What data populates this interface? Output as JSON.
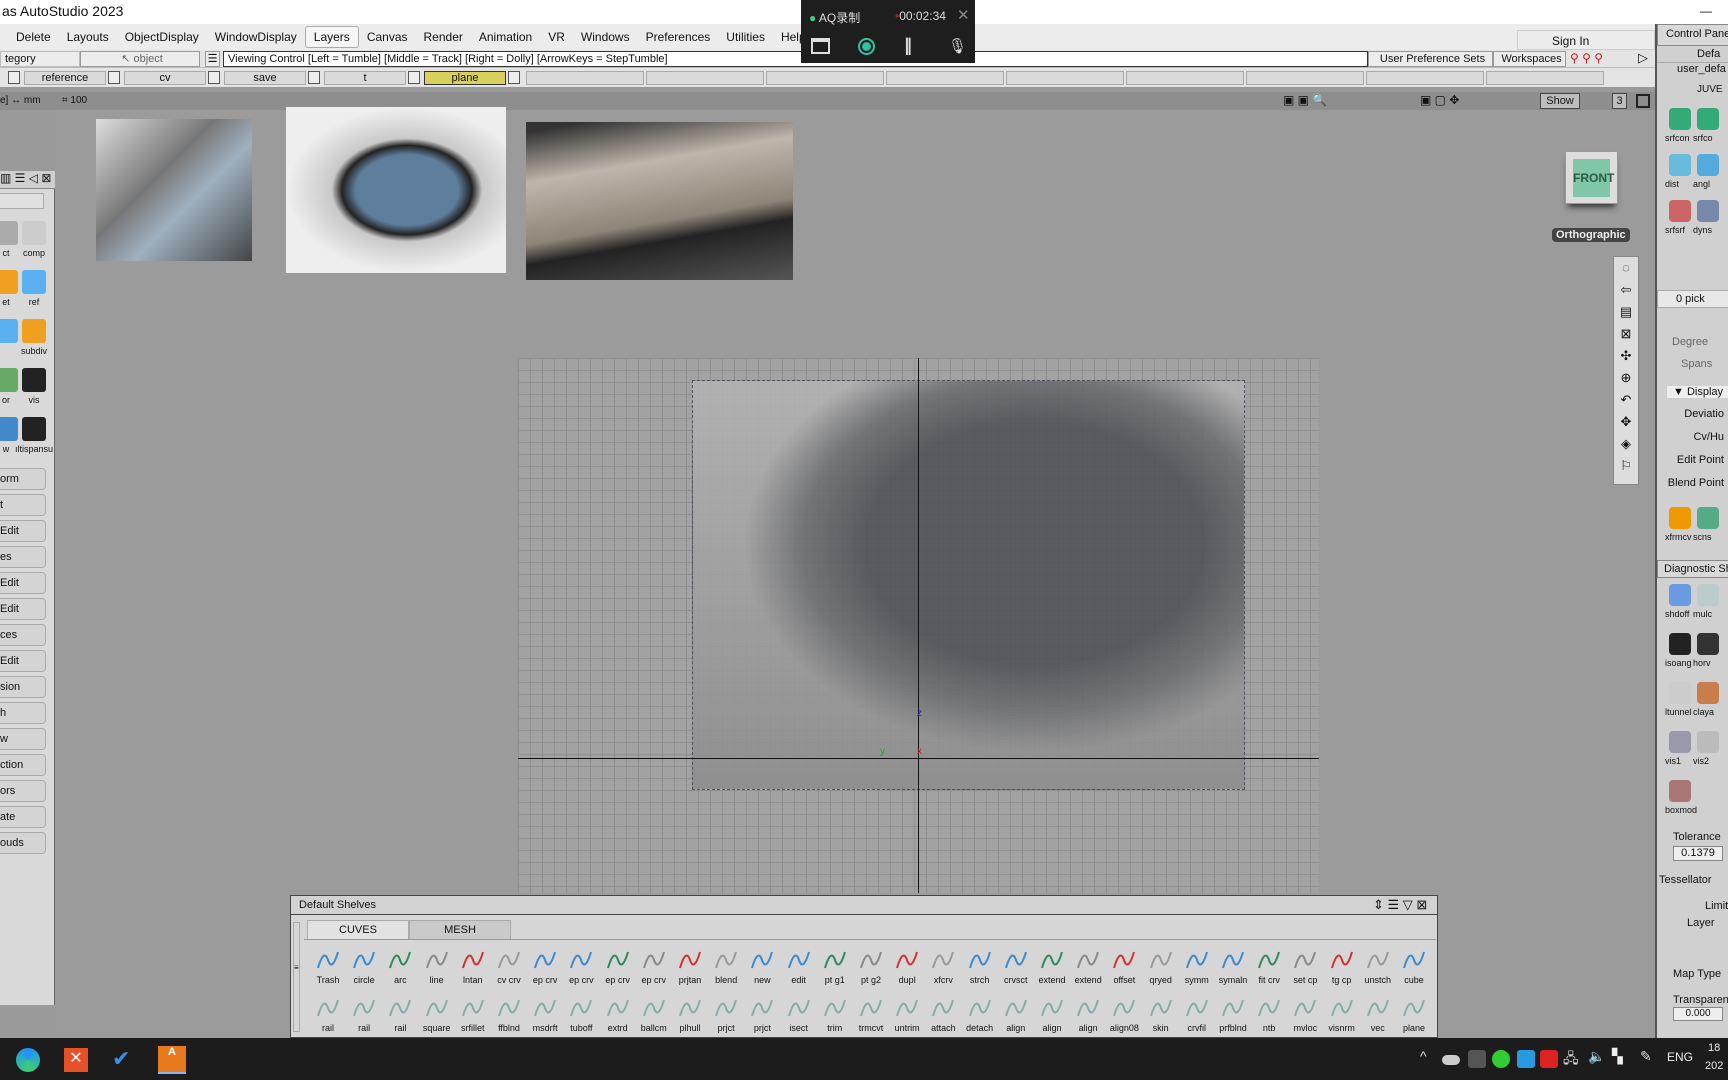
{
  "app": {
    "title": "as AutoStudio 2023"
  },
  "menu": [
    "Delete",
    "Layouts",
    "ObjectDisplay",
    "WindowDisplay",
    "Layers",
    "Canvas",
    "Render",
    "Animation",
    "VR",
    "Windows",
    "Preferences",
    "Utilities",
    "Help"
  ],
  "menu_active": "Layers",
  "toolbar": {
    "category": "tegory",
    "object": "object",
    "viewing_control": "Viewing Control   [Left = Tumble]   [Middle = Track]   [Right = Dolly]   [ArrowKeys = StepTumble]",
    "user_pref_sets": "User Preference Sets",
    "workspaces": "Workspaces",
    "sign_in": "Sign In"
  },
  "layers": [
    {
      "label": "reference",
      "active": false
    },
    {
      "label": "cv",
      "active": false
    },
    {
      "label": "save",
      "active": false
    },
    {
      "label": "t",
      "active": false
    },
    {
      "label": "plane",
      "active": true
    }
  ],
  "viewport_header": {
    "units": "e] ↔ mm",
    "grid": "100",
    "show": "Show",
    "count": "3"
  },
  "recorder": {
    "name": "AQ录制",
    "time": "00:02:34"
  },
  "viewport": {
    "view_cube": "FRONT",
    "projection": "Orthographic",
    "axis_z": "z",
    "axis_x": "x",
    "axis_y": "y"
  },
  "left_panel": {
    "icons": [
      {
        "label": "ct"
      },
      {
        "label": "comp"
      },
      {
        "label": "et"
      },
      {
        "label": "ref"
      },
      {
        "label": ""
      },
      {
        "label": "subdiv"
      },
      {
        "label": "or"
      },
      {
        "label": "vis"
      },
      {
        "label": "w"
      },
      {
        "label": "ıltispansu"
      }
    ],
    "sections": [
      "orm",
      "t",
      "Edit",
      "es",
      "Edit",
      "Edit",
      "ces",
      "Edit",
      "sion",
      "h",
      "w",
      "ction",
      "ors",
      "ate",
      "ouds"
    ]
  },
  "right_panel": {
    "header": "Control Pane",
    "preset": "Defa",
    "user": "user_defa",
    "shelf_title": "JUVE",
    "tools": [
      "srfcon",
      "srfco",
      "dist",
      "angl",
      "srfsrf",
      "dyns"
    ],
    "picked": "0 pick",
    "degree_label": "Degree",
    "spans_label": "Spans",
    "display": "Display",
    "display_items": [
      "Deviatio",
      "Cv/Hu",
      "Edit Point",
      "Blend Point"
    ],
    "tools2": [
      "xfrmcv",
      "scns"
    ],
    "diagnostic": "Diagnostic Sh",
    "diag_tools": [
      "shdoff",
      "mulc",
      "isoang",
      "horv",
      "ltunnel",
      "claya",
      "vis1",
      "vis2",
      "boxmod"
    ],
    "tolerance_label": "Tolerance",
    "tolerance": "0.1379",
    "tessellator": "Tessellator",
    "limit": "Limit",
    "layer": "Layer",
    "map_type": "Map Type",
    "transparency": "Transparenc",
    "transparency_value": "0.000"
  },
  "shelf": {
    "title": "Default Shelves",
    "tabs": [
      "CUVES",
      "MESH"
    ],
    "active_tab": "CUVES",
    "row1": [
      "Trash",
      "circle",
      "arc",
      "line",
      "lntan",
      "cv crv",
      "ep crv",
      "ep crv",
      "ep crv",
      "ep crv",
      "prjtan",
      "blend",
      "new",
      "edit",
      "pt g1",
      "pt g2",
      "dupl",
      "xfcrv",
      "strch",
      "crvsct",
      "extend",
      "extend",
      "offset",
      "qryed",
      "symm",
      "symaln",
      "fit crv",
      "set cp",
      "tg cp",
      "unstch",
      "cube"
    ],
    "row2": [
      "rail",
      "rail",
      "rail",
      "square",
      "srfillet",
      "ffblnd",
      "msdrft",
      "tuboff",
      "extrd",
      "ballcm",
      "plhull",
      "prjct",
      "prjct",
      "isect",
      "trim",
      "trmcvt",
      "untrim",
      "attach",
      "detach",
      "align",
      "align",
      "align",
      "align08",
      "skin",
      "crvfil",
      "prfblnd",
      "ntb",
      "mvloc",
      "visnrm",
      "vec",
      "plane"
    ]
  },
  "taskbar": {
    "apps": [
      "edge-icon",
      "office-icon",
      "todo-icon",
      "alias-icon"
    ],
    "language": "ENG",
    "time": "18",
    "date": "202"
  },
  "colors": {
    "layer_active": "#d8d05a",
    "accent_green": "#2ec4a0",
    "viewcube": "#7fc7a8"
  }
}
